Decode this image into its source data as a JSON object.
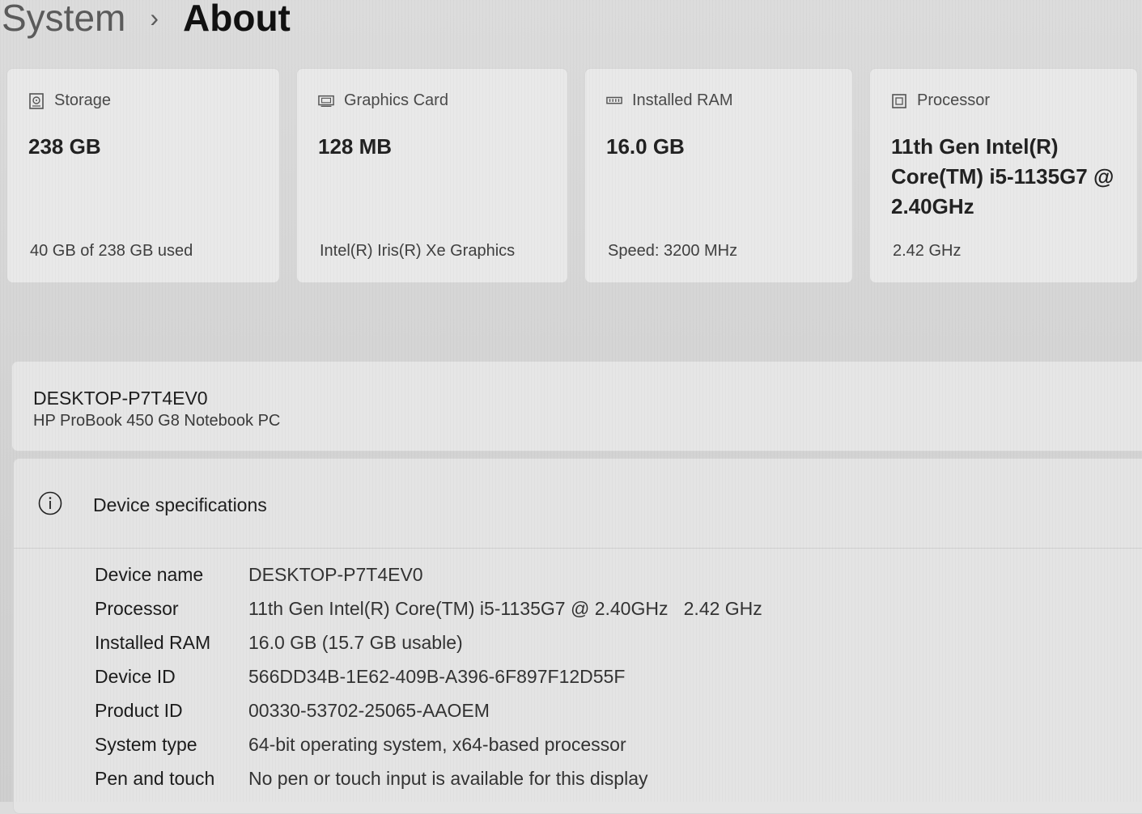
{
  "breadcrumb": {
    "parent": "System",
    "separator": "›",
    "current": "About"
  },
  "cards": [
    {
      "icon": "storage-icon",
      "label": "Storage",
      "value": "238 GB",
      "sub": "40 GB of 238 GB used"
    },
    {
      "icon": "graphics-card-icon",
      "label": "Graphics Card",
      "value": "128 MB",
      "sub": "Intel(R) Iris(R) Xe Graphics"
    },
    {
      "icon": "ram-icon",
      "label": "Installed RAM",
      "value": "16.0 GB",
      "sub": "Speed: 3200 MHz"
    },
    {
      "icon": "processor-icon",
      "label": "Processor",
      "value_lines": [
        "11th Gen Intel(R)",
        "Core(TM) i5-1135G7 @",
        "2.40GHz"
      ],
      "sub": "2.42 GHz"
    }
  ],
  "device": {
    "name": "DESKTOP-P7T4EV0",
    "model": "HP ProBook 450 G8 Notebook PC"
  },
  "specs": {
    "icon": "info-icon",
    "title": "Device specifications",
    "rows": [
      {
        "label": "Device name",
        "value": "DESKTOP-P7T4EV0"
      },
      {
        "label": "Processor",
        "value": "11th Gen Intel(R) Core(TM) i5-1135G7 @ 2.40GHz   2.42 GHz"
      },
      {
        "label": "Installed RAM",
        "value": "16.0 GB (15.7 GB usable)"
      },
      {
        "label": "Device ID",
        "value": "566DD34B-1E62-409B-A396-6F897F12D55F"
      },
      {
        "label": "Product ID",
        "value": "00330-53702-25065-AAOEM"
      },
      {
        "label": "System type",
        "value": "64-bit operating system, x64-based processor"
      },
      {
        "label": "Pen and touch",
        "value": "No pen or touch input is available for this display"
      }
    ]
  }
}
